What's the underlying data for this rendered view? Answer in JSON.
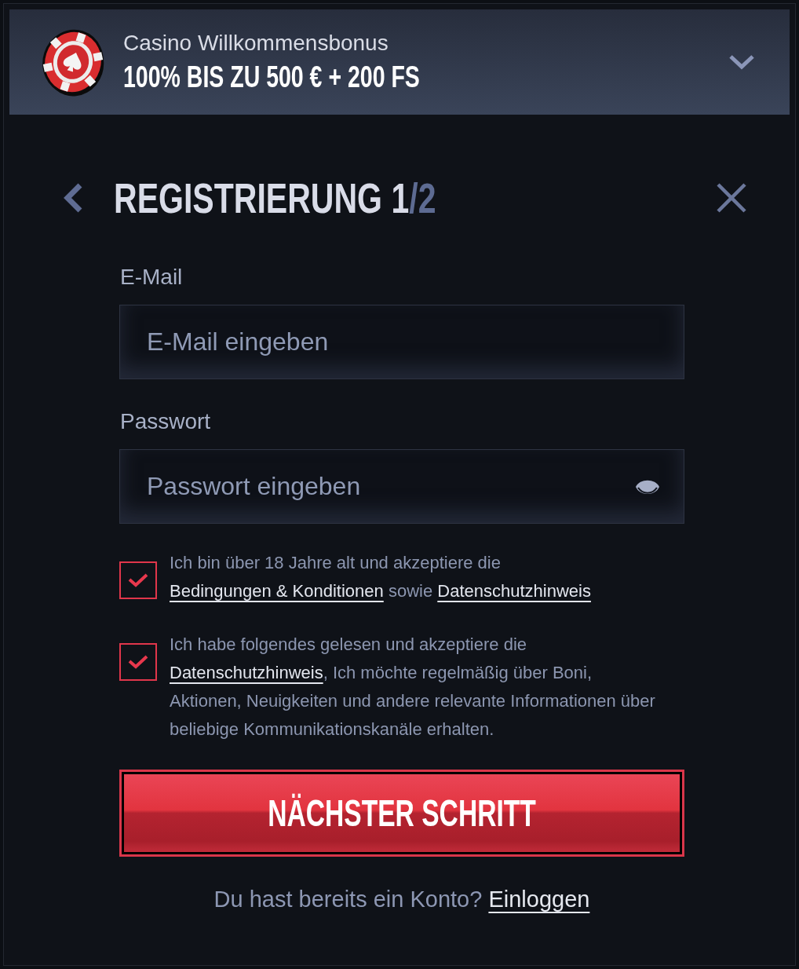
{
  "bonus_banner": {
    "subtitle": "Casino Willkommensbonus",
    "offer": "100% BIS ZU 500 € + 200 FS",
    "expanded": false
  },
  "header": {
    "title": "REGISTRIERUNG",
    "step": "1",
    "step_total": "/2"
  },
  "fields": [
    {
      "kind": "email",
      "label": "E-Mail",
      "placeholder": "E-Mail eingeben"
    },
    {
      "kind": "password",
      "label": "Passwort",
      "placeholder": "Passwort eingeben"
    }
  ],
  "consents": [
    {
      "checked": true,
      "parts": [
        {
          "kind": "text",
          "text": "Ich bin über 18 Jahre alt und akzeptiere die "
        },
        {
          "kind": "link",
          "text": "Bedingungen & Konditionen"
        },
        {
          "kind": "text",
          "text": " sowie "
        },
        {
          "kind": "link",
          "text": "Datenschutzhinweis"
        }
      ]
    },
    {
      "checked": true,
      "parts": [
        {
          "kind": "text",
          "text": "Ich habe folgendes gelesen und akzeptiere die "
        },
        {
          "kind": "link",
          "text": "Datenschutzhinweis"
        },
        {
          "kind": "text",
          "text": ", Ich möchte regelmäßig über Boni, Aktionen, Neuigkeiten und andere relevante Informationen über beliebige Kommunikationskanäle erhalten."
        }
      ]
    }
  ],
  "next_button": {
    "label": "NÄCHSTER SCHRITT"
  },
  "login_prompt": {
    "question": "Du hast bereits ein Konto?",
    "link": "Einloggen"
  }
}
